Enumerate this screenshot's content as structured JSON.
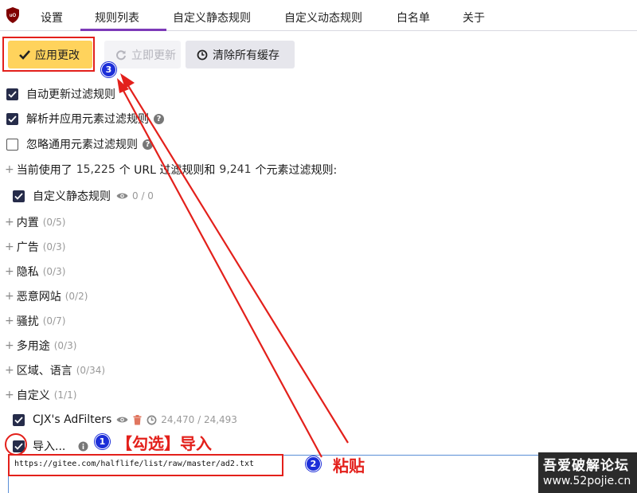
{
  "tabs": [
    {
      "label": "设置"
    },
    {
      "label": "规则列表"
    },
    {
      "label": "自定义静态规则"
    },
    {
      "label": "自定义动态规则"
    },
    {
      "label": "白名单"
    },
    {
      "label": "关于"
    }
  ],
  "toolbar": {
    "apply_label": "应用更改",
    "update_label": "立即更新",
    "purge_label": "清除所有缓存"
  },
  "settings": {
    "auto_update": {
      "label": "自动更新过滤规则",
      "checked": true
    },
    "parse_cosmetic": {
      "label": "解析并应用元素过滤规则",
      "checked": true
    },
    "ignore_generic": {
      "label": "忽略通用元素过滤规则",
      "checked": false
    }
  },
  "stats": {
    "prefix": "当前使用了",
    "url_count": "15,225",
    "mid": "个 URL 过滤规则和",
    "cosmetic_count": "9,241",
    "suffix": "个元素过滤规则:"
  },
  "custom_static": {
    "label": "自定义静态规则",
    "count": "0 / 0"
  },
  "groups": [
    {
      "label": "内置",
      "count": "(0/5)"
    },
    {
      "label": "广告",
      "count": "(0/3)"
    },
    {
      "label": "隐私",
      "count": "(0/3)"
    },
    {
      "label": "恶意网站",
      "count": "(0/2)"
    },
    {
      "label": "骚扰",
      "count": "(0/7)"
    },
    {
      "label": "多用途",
      "count": "(0/3)"
    },
    {
      "label": "区域、语言",
      "count": "(0/34)"
    },
    {
      "label": "自定义",
      "count": "(1/1)"
    }
  ],
  "custom_list": {
    "label": "CJX's AdFilters",
    "count": "24,470 / 24,493"
  },
  "import": {
    "label": "导入...",
    "checked": true
  },
  "url_input": {
    "value": "https://gitee.com/halflife/list/raw/master/ad2.txt"
  },
  "annotations": {
    "badge1": "1",
    "badge2": "2",
    "badge3": "3",
    "text1": "【勾选】导入",
    "text2": "粘贴",
    "color": "#e3201b"
  },
  "watermark": {
    "line1": "吾爱破解论坛",
    "line2": "www.52pojie.cn"
  },
  "colors": {
    "accent": "#7d3ab8",
    "apply_button": "#ffd35c",
    "checkbox": "#262c4a",
    "badge": "#1c2ed8"
  }
}
